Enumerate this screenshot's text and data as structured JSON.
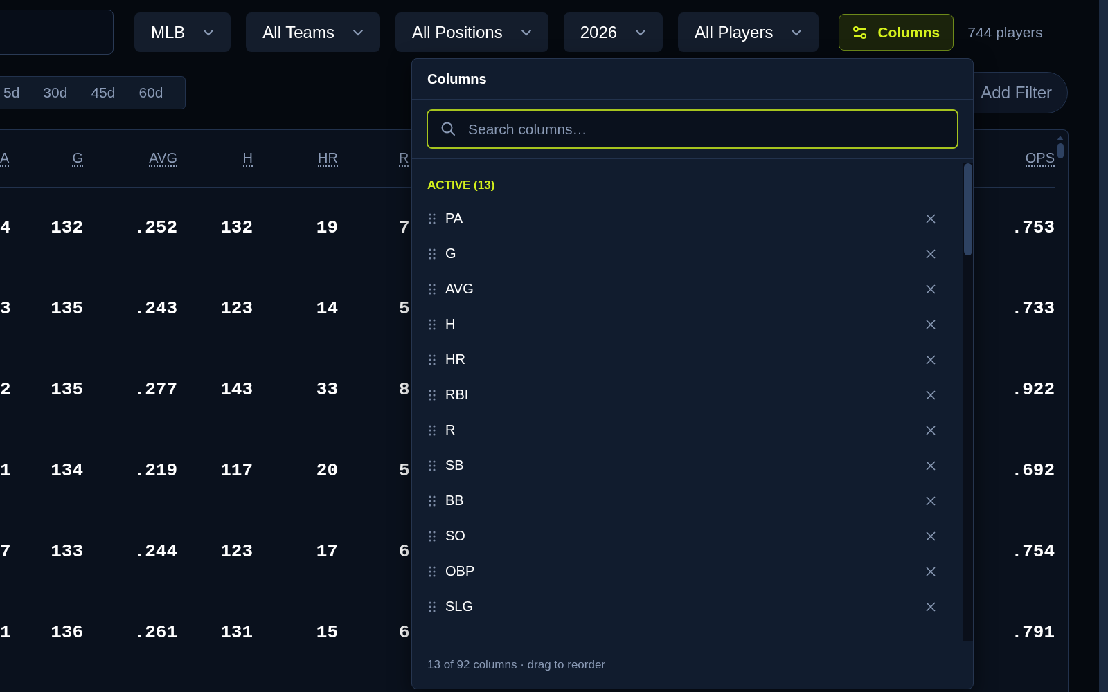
{
  "filters": [
    {
      "label": "MLB"
    },
    {
      "label": "All Teams"
    },
    {
      "label": "All Positions"
    },
    {
      "label": "2026"
    },
    {
      "label": "All Players"
    }
  ],
  "columns_button": {
    "label": "Columns",
    "active": true
  },
  "player_count": "744 players",
  "periods": [
    {
      "label": "5d"
    },
    {
      "label": "30d"
    },
    {
      "label": "45d"
    },
    {
      "label": "60d"
    }
  ],
  "add_filter": "Add Filter",
  "table": {
    "columns": [
      "A",
      "G",
      "AVG",
      "H",
      "HR",
      "R",
      "OPS"
    ],
    "rows": [
      [
        "4",
        "132",
        ".252",
        "132",
        "19",
        "7",
        ".753"
      ],
      [
        "3",
        "135",
        ".243",
        "123",
        "14",
        "5",
        ".733"
      ],
      [
        "2",
        "135",
        ".277",
        "143",
        "33",
        "8",
        ".922"
      ],
      [
        "1",
        "134",
        ".219",
        "117",
        "20",
        "5",
        ".692"
      ],
      [
        "7",
        "133",
        ".244",
        "123",
        "17",
        "6",
        ".754"
      ],
      [
        "1",
        "136",
        ".261",
        "131",
        "15",
        "6",
        ".791"
      ]
    ]
  },
  "columns_menu": {
    "title": "Columns",
    "search": {
      "placeholder": "Search columns…"
    },
    "section": "ACTIVE (13)",
    "items": [
      {
        "label": "PA"
      },
      {
        "label": "G"
      },
      {
        "label": "AVG"
      },
      {
        "label": "H"
      },
      {
        "label": "HR"
      },
      {
        "label": "RBI"
      },
      {
        "label": "R"
      },
      {
        "label": "SB"
      },
      {
        "label": "BB"
      },
      {
        "label": "SO"
      },
      {
        "label": "OBP"
      },
      {
        "label": "SLG"
      }
    ],
    "footer": "13 of 92 columns · drag to reorder"
  }
}
